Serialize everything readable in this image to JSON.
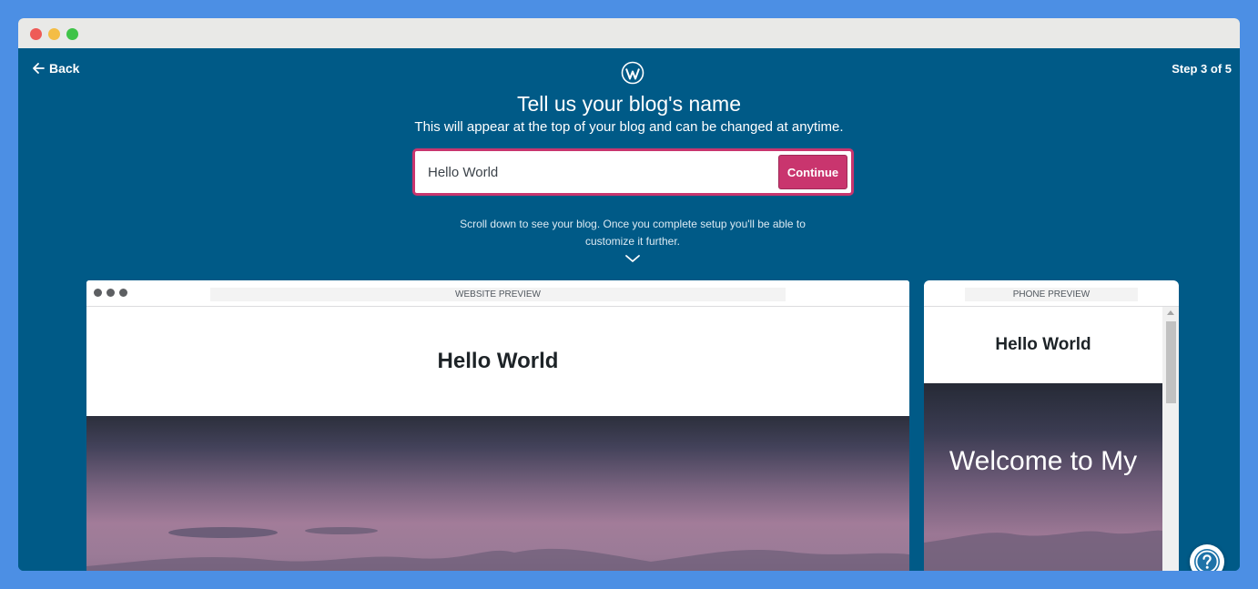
{
  "window": {
    "traffic_lights": [
      "close",
      "minimize",
      "maximize"
    ]
  },
  "nav": {
    "back_label": "Back",
    "step_label": "Step 3 of 5"
  },
  "header": {
    "logo_icon": "wordpress-icon",
    "title": "Tell us your blog's name",
    "subtitle": "This will appear at the top of your blog and can be changed at anytime."
  },
  "form": {
    "blog_name_value": "Hello World",
    "continue_label": "Continue"
  },
  "hint": {
    "text": "Scroll down to see your blog. Once you complete setup you'll be able to customize it further.",
    "icon": "chevron-down-icon"
  },
  "website_preview": {
    "label": "WEBSITE PREVIEW",
    "site_title": "Hello World"
  },
  "phone_preview": {
    "label": "PHONE PREVIEW",
    "site_title": "Hello World",
    "hero_text": "Welcome to My"
  },
  "help": {
    "icon": "help-icon"
  },
  "colors": {
    "accent": "#c9356e",
    "background": "#005a87",
    "outer": "#4c8fe4"
  }
}
